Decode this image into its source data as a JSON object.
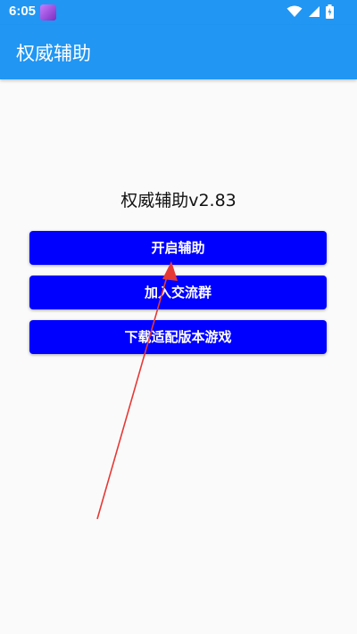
{
  "status_bar": {
    "time": "6:05",
    "icons": [
      "app-notification-icon",
      "wifi-icon",
      "signal-icon",
      "battery-icon"
    ]
  },
  "app_bar": {
    "title": "权威辅助",
    "color": "#2196f3"
  },
  "main": {
    "heading": "权威辅助v2.83",
    "buttons": {
      "start": "开启辅助",
      "join_group": "加入交流群",
      "download": "下载适配版本游戏"
    },
    "button_color": "#0000ff"
  },
  "annotation": {
    "type": "arrow",
    "color": "#e53935",
    "points_to": "start-assist-button"
  }
}
